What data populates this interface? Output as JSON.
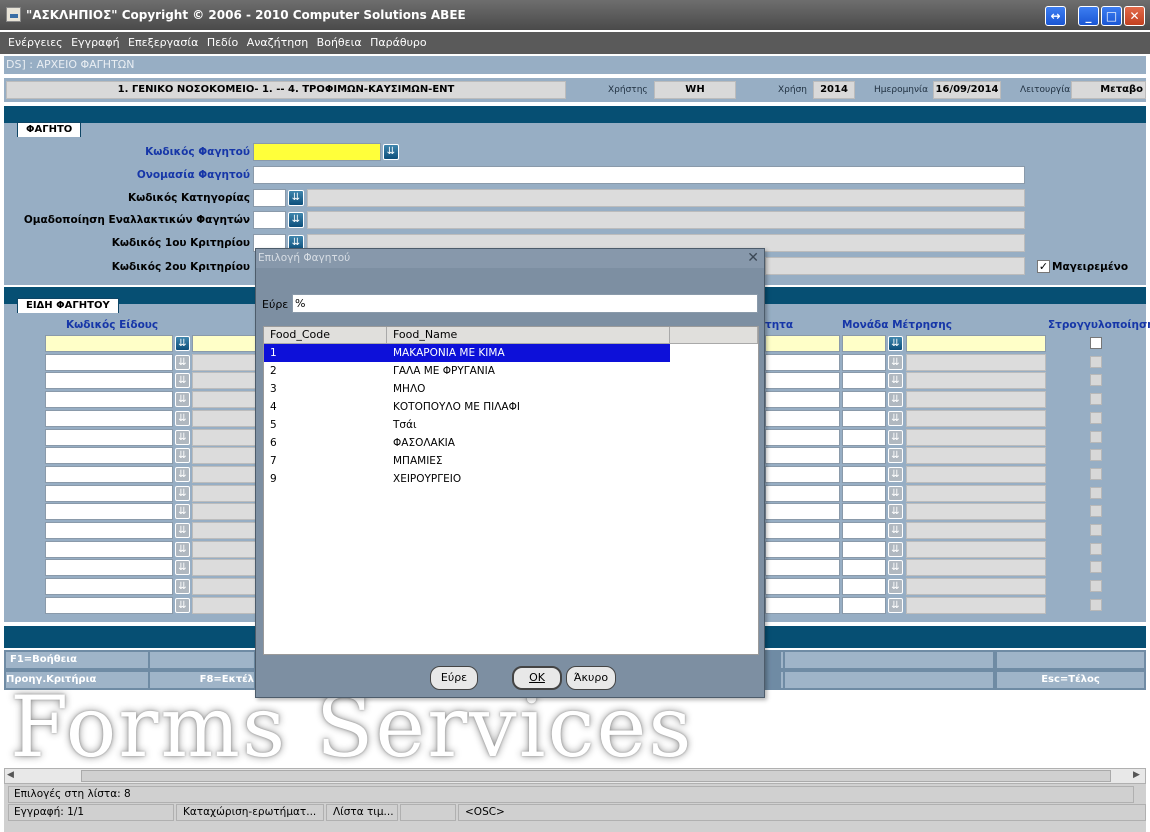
{
  "window": {
    "title": "\"ΑΣΚΛΗΠΙΟΣ\" Copyright © 2006 - 2010 Computer Solutions ΑΒΕΕ",
    "btn_resize": "↔",
    "btn_min": "_",
    "btn_max": "□",
    "btn_close": "✕"
  },
  "menu": [
    "Ενέργειες",
    "Εγγραφή",
    "Επεξεργασία",
    "Πεδίο",
    "Αναζήτηση",
    "Βοήθεια",
    "Παράθυρο"
  ],
  "breadcrumb": "DS]  :  ΑΡΧΕΙΟ ΦΑΓΗΤΩΝ",
  "info": {
    "hospital": "1. ΓΕΝΙΚΟ ΝΟΣΟΚΟΜΕΙΟ- 1. -- 4. ΤΡΟΦΙΜΩΝ-ΚΑΥΣΙΜΩΝ-ΕΝΤ",
    "user_label": "Χρήστης",
    "user": "WH",
    "year_label": "Χρήση",
    "year": "2014",
    "date_label": "Ημερομηνία",
    "date": "16/09/2014",
    "mode_label": "Λειτουργία",
    "mode": "Μεταβο"
  },
  "food_section": {
    "tab": "ΦΑΓΗΤΟ",
    "code_label": "Κωδικός Φαγητού",
    "name_label": "Ονομασία Φαγητού",
    "category_label": "Κωδικός Κατηγορίας",
    "alt_group_label": "Ομαδοποίηση Εναλλακτικών Φαγητών",
    "crit1_label": "Κωδικός 1ου Κριτηρίου",
    "crit2_label": "Κωδικός 2ου Κριτηρίου",
    "cooked_label": "Μαγειρεμένο",
    "cooked_checked": true
  },
  "items_section": {
    "tab": "ΕΙΔΗ ΦΑΓΗΤΟΥ",
    "col_code": "Κωδικός Είδους",
    "col_qty": "τητα",
    "col_unit": "Μονάδα Μέτρησης",
    "col_round": "Στρογγυλοποίηση"
  },
  "buttons": {
    "help": "F1=Βοήθεια",
    "prev_crit": "Προηγ.Κριτήρια",
    "f8": "F8=Εκτέλ",
    "esc": "Esc=Τέλος"
  },
  "watermark": "Forms Services",
  "status": {
    "list_choices": "Επιλογές στη λίστα: 8",
    "record": "Εγγραφή: 1/1",
    "query": "Καταχώριση-ερωτήματ...",
    "values": "Λίστα τιμ...",
    "osc": "<OSC>"
  },
  "dialog": {
    "title": "Επιλογή Φαγητού",
    "close": "✕",
    "find_label": "Εύρε",
    "find_value": "%",
    "col_code": "Food_Code",
    "col_name": "Food_Name",
    "rows": [
      {
        "code": "1",
        "name": "ΜΑΚΑΡΟΝΙΑ ΜΕ ΚΙΜΑ"
      },
      {
        "code": "2",
        "name": "ΓΑΛΑ ΜΕ ΦΡΥΓΑΝΙΑ"
      },
      {
        "code": "3",
        "name": "ΜΗΛΟ"
      },
      {
        "code": "4",
        "name": "ΚΟΤΟΠΟΥΛΟ ΜΕ ΠΙΛΑΦΙ"
      },
      {
        "code": "5",
        "name": "Τσάι"
      },
      {
        "code": "6",
        "name": "ΦΑΣΟΛΑΚΙΑ"
      },
      {
        "code": "7",
        "name": "ΜΠΑΜΙΕΣ"
      },
      {
        "code": "9",
        "name": "ΧΕΙΡΟΥΡΓΕΙΟ"
      }
    ],
    "btn_find": "Εύρε",
    "btn_ok": "OK",
    "btn_cancel": "Άκυρο"
  }
}
